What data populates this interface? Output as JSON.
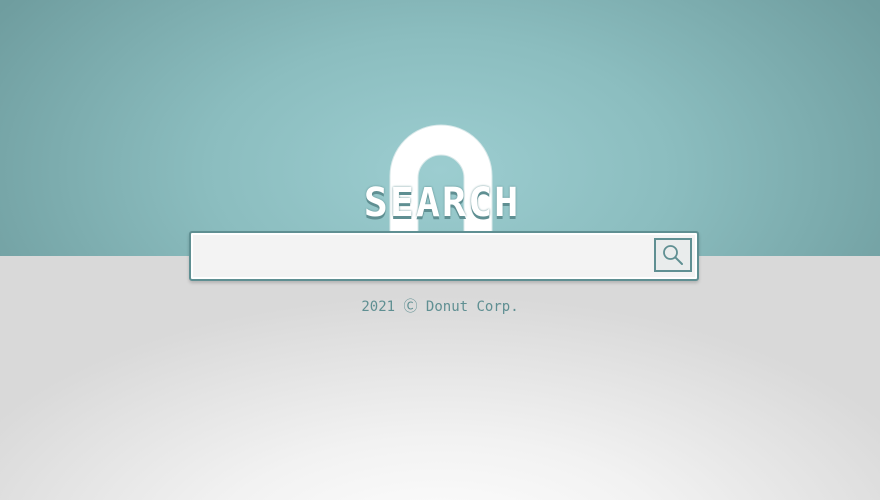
{
  "logo": {
    "text": "SEARCH"
  },
  "search": {
    "value": "",
    "placeholder": "",
    "button_icon": "magnifier-icon"
  },
  "footer": {
    "text": "2021 Ⓒ Donut Corp."
  },
  "colors": {
    "teal_dark": "#5f8f92",
    "teal_light": "#9ccdd0",
    "background_light": "#f2f2f2"
  }
}
